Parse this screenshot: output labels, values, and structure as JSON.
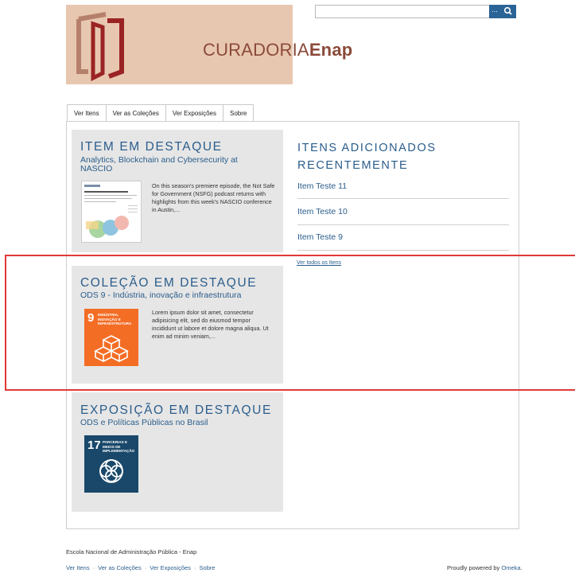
{
  "header": {
    "logo_text_part1": "CURADORIA",
    "logo_text_part2": "Enap",
    "search": {
      "value": "",
      "options_label": "...",
      "submit_icon": "search-icon"
    }
  },
  "nav": {
    "tabs": [
      {
        "label": "Ver Itens"
      },
      {
        "label": "Ver as Coleções"
      },
      {
        "label": "Ver Exposições"
      },
      {
        "label": "Sobre"
      }
    ]
  },
  "featured_item": {
    "heading": "ITEM EM DESTAQUE",
    "title": "Analytics, Blockchain and Cybersecurity at NASCIO",
    "description": "On this season's premiere episode, the Not Safe for Government (NSFG) podcast returns with highlights from this week's NASCIO conference in Austin,..."
  },
  "featured_collection": {
    "heading": "COLEÇÃO EM DESTAQUE",
    "title": "ODS 9 - Indústria, inovação e infraestrutura",
    "description": "Lorem ipsum dolor sit amet, consectetur adipisicing elit, sed do eiusmod tempor incididunt ut labore et dolore magna aliqua. Ut enim ad minim veniam,...",
    "badge_number": "9",
    "badge_text": "INDÚSTRIA, INOVAÇÃO E INFRAESTRUTURA",
    "badge_color": "#f36d25"
  },
  "featured_exhibit": {
    "heading": "EXPOSIÇÃO EM DESTAQUE",
    "title": "ODS e Políticas Públicas no Brasil",
    "badge_number": "17",
    "badge_text": "PARCERIAS E MEIOS DE IMPLEMENTAÇÃO",
    "badge_color": "#19486a"
  },
  "recent": {
    "heading_line1": "ITENS ADICIONADOS",
    "heading_line2": "RECENTEMENTE",
    "items": [
      {
        "label": "Item Teste 11"
      },
      {
        "label": "Item Teste 10"
      },
      {
        "label": "Item Teste 9"
      }
    ],
    "view_all": "Ver todos os Itens"
  },
  "footer": {
    "org": "Escola Nacional de Administração Pública - Enap",
    "links": [
      {
        "label": "Ver Itens"
      },
      {
        "label": "Ver as Coleções"
      },
      {
        "label": "Ver Exposições"
      },
      {
        "label": "Sobre"
      }
    ],
    "powered_prefix": "Proudly powered by ",
    "powered_link": "Omeka",
    "powered_suffix": "."
  },
  "colors": {
    "link": "#2a5d8c",
    "panel": "#e6e6e6",
    "highlight": "#e03a3a",
    "logo_bg": "#e8c7b0"
  }
}
